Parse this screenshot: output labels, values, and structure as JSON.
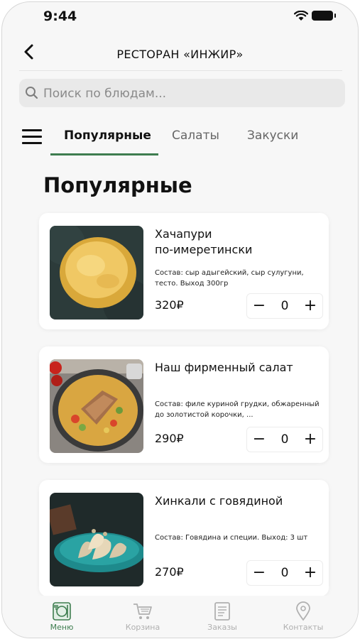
{
  "status_bar": {
    "time": "9:44"
  },
  "header": {
    "title": "РЕСТОРАН «ИНЖИР»"
  },
  "search": {
    "placeholder": "Поиск по блюдам..."
  },
  "tabs": [
    {
      "label": "Популярные",
      "active": true
    },
    {
      "label": "Салаты",
      "active": false
    },
    {
      "label": "Закуски",
      "active": false
    }
  ],
  "section": {
    "title": "Популярные"
  },
  "dishes": [
    {
      "name": "Хачапури\nпо-имеретински",
      "description": "Состав: сыр адыгейский, сыр сулугуни, тесто. Выход 300гр",
      "price": "320₽",
      "quantity": "0",
      "image_icon": "khachapuri-image"
    },
    {
      "name": "Наш фирменный салат",
      "description": "Состав: филе куриной грудки, обжаренный до золотистой корочки, ...",
      "price": "290₽",
      "quantity": "0",
      "image_icon": "salad-image"
    },
    {
      "name": "Хинкали с говядиной",
      "description": "Состав: Говядина и специи. Выход: 3 шт",
      "price": "270₽",
      "quantity": "0",
      "image_icon": "khinkali-image"
    }
  ],
  "stepper": {
    "minus": "−",
    "plus": "+"
  },
  "bottom_nav": [
    {
      "label": "Меню",
      "icon": "plate-icon",
      "active": true
    },
    {
      "label": "Корзина",
      "icon": "cart-icon",
      "active": false
    },
    {
      "label": "Заказы",
      "icon": "orders-icon",
      "active": false
    },
    {
      "label": "Контакты",
      "icon": "location-pin-icon",
      "active": false
    }
  ],
  "colors": {
    "accent": "#3e7d4f",
    "background": "#f7f7f7",
    "inactive_nav": "#b0b0b0"
  }
}
